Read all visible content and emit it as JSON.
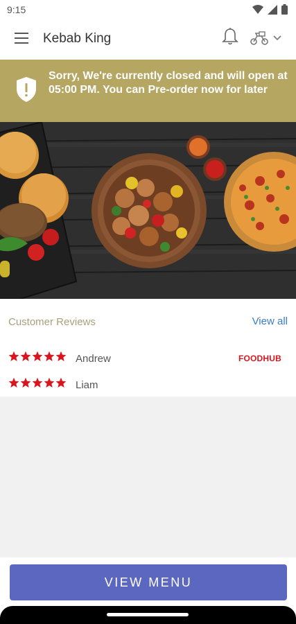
{
  "status_bar": {
    "time": "9:15",
    "icons": [
      "wifi-icon",
      "signal-icon",
      "battery-icon"
    ]
  },
  "app_bar": {
    "title": "Kebab King",
    "icons": [
      "menu-icon",
      "bell-icon",
      "delivery-mode-icon",
      "chevron-down-icon"
    ]
  },
  "closed_banner": {
    "message": "Sorry, We're currently closed and will open at 05:00 PM. You can Pre-order now for later",
    "icon": "shield-alert-icon",
    "color": "#b5a662"
  },
  "reviews": {
    "title": "Customer Reviews",
    "view_all": "View all",
    "items": [
      {
        "name": "Andrew",
        "rating": 5,
        "source": "FOODHUB"
      },
      {
        "name": "Liam",
        "rating": 5
      }
    ]
  },
  "actions": {
    "view_menu": "VIEW MENU"
  },
  "colors": {
    "accent": "#5c68bf",
    "banner": "#b5a662",
    "star": "#d7161f",
    "link": "#3a7ec6"
  }
}
